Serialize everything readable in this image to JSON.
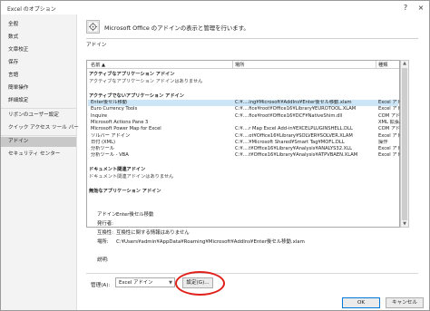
{
  "window": {
    "title": "Excel のオプション",
    "help": "?",
    "close": "×"
  },
  "sidebar": {
    "items": [
      {
        "label": "全般",
        "active": false
      },
      {
        "label": "数式",
        "active": false
      },
      {
        "label": "文章校正",
        "active": false
      },
      {
        "label": "保存",
        "active": false
      },
      {
        "label": "言語",
        "active": false
      },
      {
        "label": "簡単操作",
        "active": false
      },
      {
        "label": "詳細設定",
        "active": false
      },
      {
        "label": "リボンのユーザー設定",
        "active": false
      },
      {
        "label": "クイック アクセス ツール バー",
        "active": false
      },
      {
        "label": "アドイン",
        "active": true
      },
      {
        "label": "セキュリティ センター",
        "active": false
      }
    ]
  },
  "header": {
    "text": "Microsoft Office のアドインの表示と管理を行います。"
  },
  "addins": {
    "section_label": "アドイン",
    "columns": {
      "name": "名前 ▲",
      "location": "場所",
      "type": "種類"
    },
    "active_group": "アクティブなアプリケーション アドイン",
    "active_empty": "アクティブなアプリケーション アドインはありません",
    "inactive_group": "アクティブでないアプリケーション アドイン",
    "inactive_rows": [
      {
        "name": "Enter後セル移動",
        "location": "C:¥....ing¥Microsoft¥AddIns¥Enter後セル移動.xlam",
        "type": "Excel アドイン",
        "selected": true
      },
      {
        "name": "Euro Currency Tools",
        "location": "C:¥....fice¥root¥Office16¥Library¥EUROTOOL.XLAM",
        "type": "Excel アドイン",
        "selected": false
      },
      {
        "name": "Inquire",
        "location": "C:¥....fice¥root¥Office16¥DCF¥NativeShim.dll",
        "type": "COM アドイン",
        "selected": false
      },
      {
        "name": "Microsoft Actions Pane 3",
        "location": "",
        "type": "XML 拡張パック",
        "selected": false
      },
      {
        "name": "Microsoft Power Map for Excel",
        "location": "C:¥....r Map Excel Add-in¥EXCELPLUGINSHELL.DLL",
        "type": "COM アドイン",
        "selected": false
      },
      {
        "name": "ソルバー アドイン",
        "location": "C:¥....ot¥Office16¥Library¥SOLVER¥SOLVER.XLAM",
        "type": "Excel アドイン",
        "selected": false
      },
      {
        "name": "日付 (XML)",
        "location": "C:¥....¥Microsoft Shared¥Smart Tag¥MOFL.DLL",
        "type": "操作",
        "selected": false
      },
      {
        "name": "分析ツール",
        "location": "C:¥....t¥Office16¥Library¥Analysis¥ANALYS32.XLL",
        "type": "Excel アドイン",
        "selected": false
      },
      {
        "name": "分析ツール - VBA",
        "location": "C:¥....t¥Office16¥Library¥Analysis¥ATPVBAEN.XLAM",
        "type": "Excel アドイン",
        "selected": false
      }
    ],
    "doc_group": "ドキュメント関連アドイン",
    "doc_empty": "ドキュメント関連アドインはありません",
    "disabled_group": "無効なアプリケーション アドイン"
  },
  "details": {
    "addin_label": "アドイン:",
    "addin_value": "Enter後セル移動",
    "publisher_label": "発行者:",
    "publisher_value": "",
    "compat_label": "互換性:",
    "compat_value": "互換性に関する情報はありません",
    "location_label": "場所:",
    "location_value": "C:¥Users¥admin¥AppData¥Roaming¥Microsoft¥AddIns¥Enter後セル移動.xlam",
    "desc_label": "説明:",
    "desc_value": ""
  },
  "manage": {
    "label": "管理(A):",
    "selected": "Excel アドイン",
    "go_button": "設定(G)..."
  },
  "dialog": {
    "ok": "OK",
    "cancel": "キャンセル"
  },
  "colors": {
    "selection": "#cde6f7",
    "highlight_ellipse": "#e0201a"
  }
}
